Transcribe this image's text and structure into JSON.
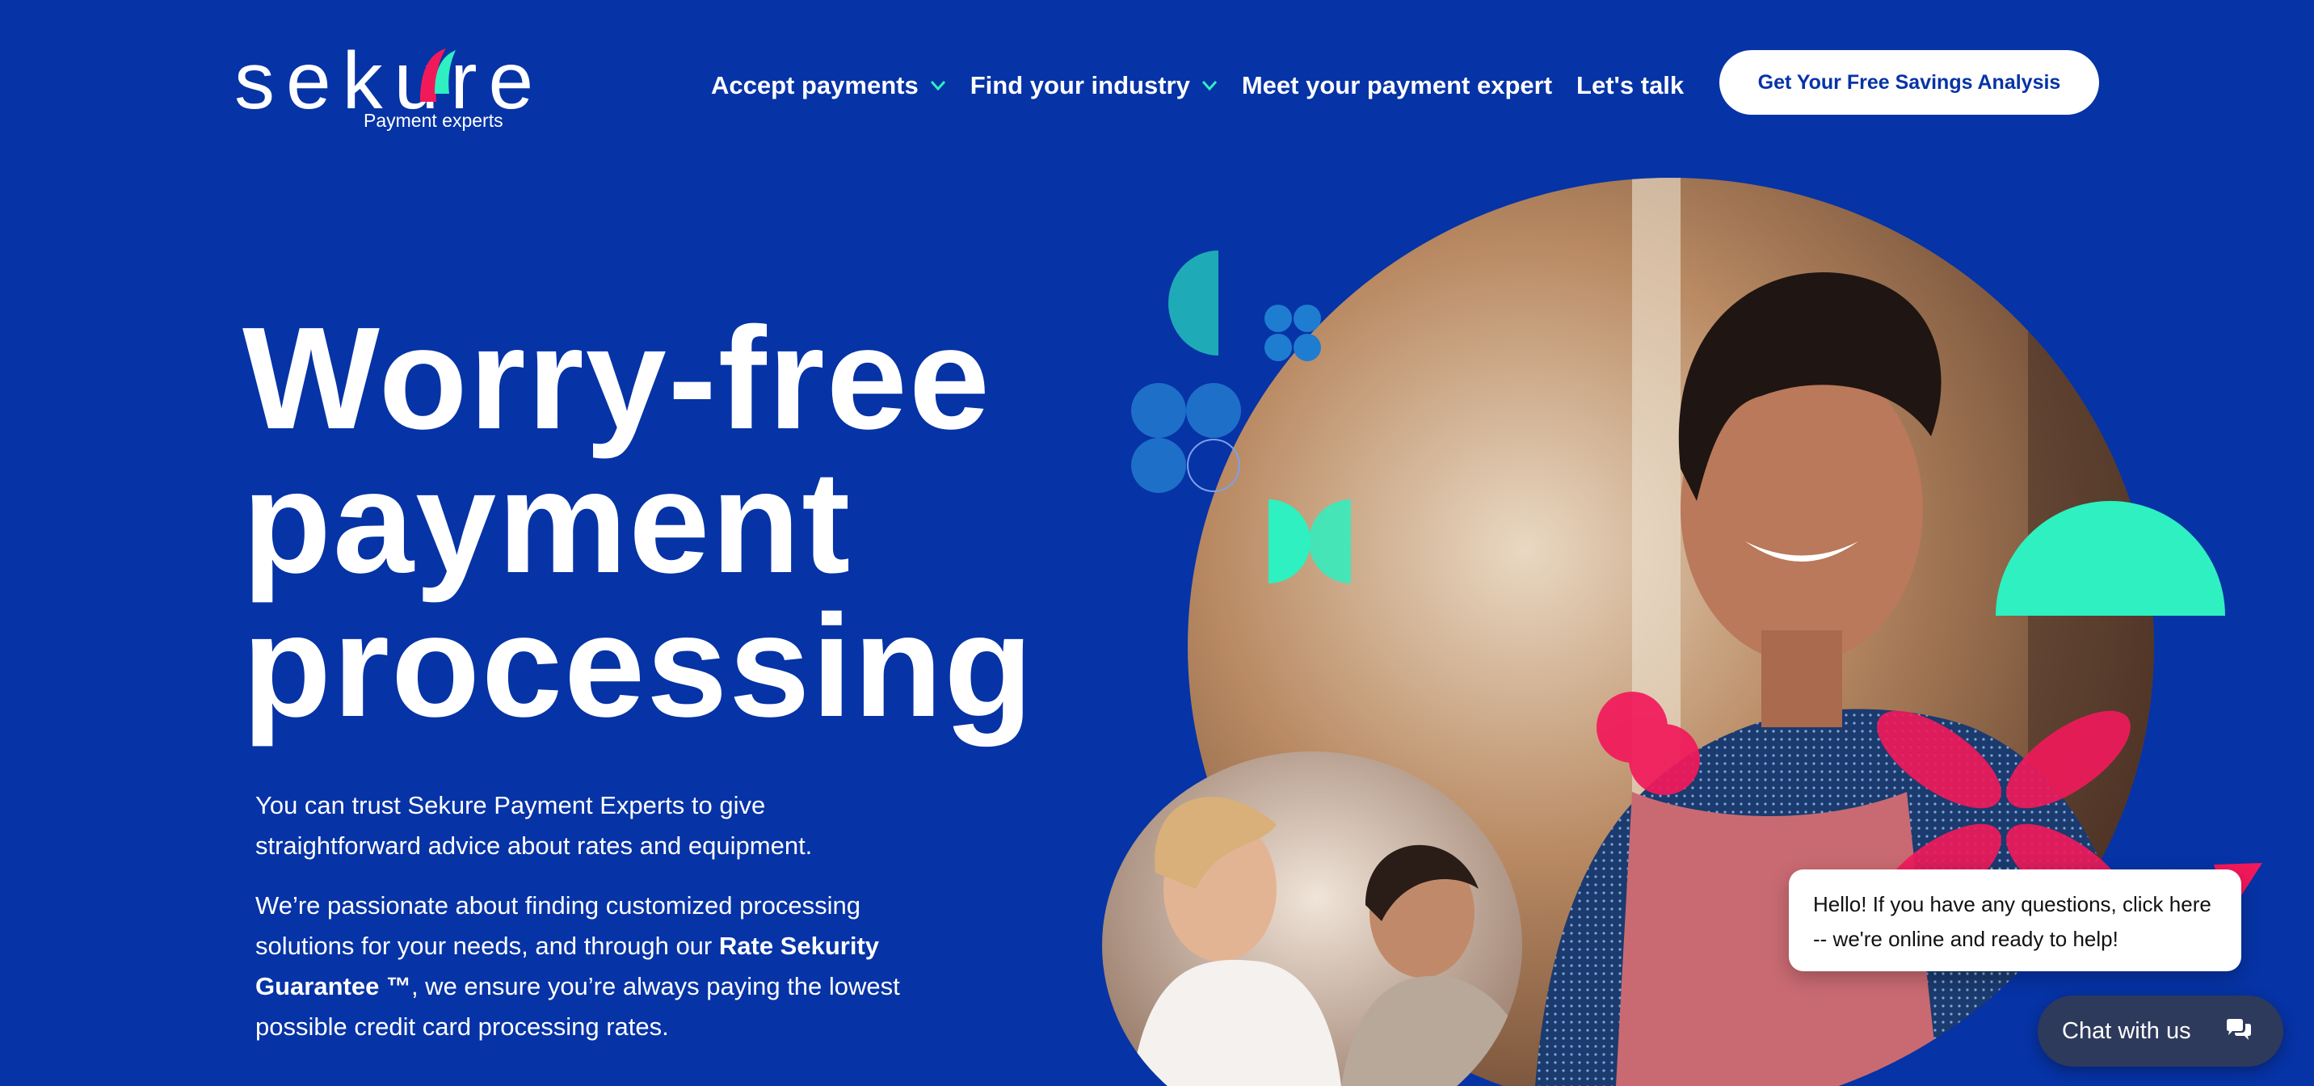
{
  "brand": {
    "name": "sekure",
    "tagline": "Payment experts"
  },
  "nav": {
    "items": [
      {
        "label": "Accept payments",
        "has_dropdown": true
      },
      {
        "label": "Find your industry",
        "has_dropdown": true
      },
      {
        "label": "Meet your payment expert",
        "has_dropdown": false
      },
      {
        "label": "Let's talk",
        "has_dropdown": false
      }
    ],
    "cta_label": "Get Your Free Savings Analysis"
  },
  "hero": {
    "title_lines": [
      "Worry-free",
      "payment",
      "processing"
    ],
    "paragraph1": "You can trust Sekure Payment Experts to give straightforward advice about rates and equipment.",
    "paragraph2_before": "We’re passionate about finding customized processing solutions for your needs, and through our ",
    "paragraph2_bold": "Rate Sekurity Guarantee ™",
    "paragraph2_after": ", we ensure you’re always paying the lowest possible credit card processing rates."
  },
  "chat": {
    "bubble_text": "Hello! If you have any questions, click here -- we're online and ready to help!",
    "button_label": "Chat with us",
    "icon": "chat-bubbles-icon"
  },
  "colors": {
    "background": "#0633a6",
    "accent_teal": "#2ef0c0",
    "accent_pink": "#f2195b",
    "cta_text": "#0633a6"
  },
  "icons": [
    "chevron-down-icon",
    "chat-bubbles-icon"
  ]
}
